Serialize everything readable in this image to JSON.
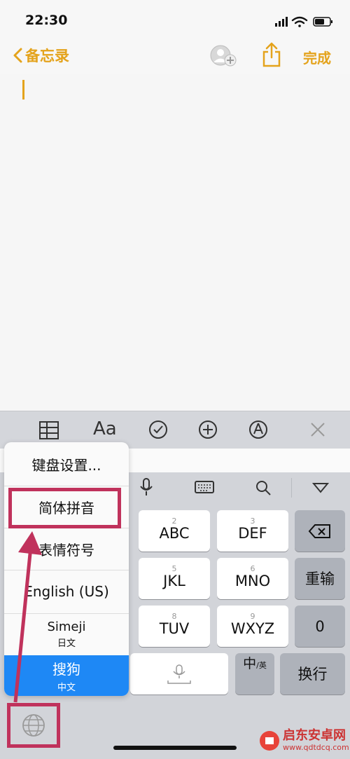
{
  "status": {
    "time": "22:30"
  },
  "nav": {
    "back_label": "备忘录",
    "done_label": "完成"
  },
  "keys": [
    {
      "num": "2",
      "label": "ABC"
    },
    {
      "num": "3",
      "label": "DEF"
    },
    {
      "num": "5",
      "label": "JKL"
    },
    {
      "num": "6",
      "label": "MNO"
    },
    {
      "num": "8",
      "label": "TUV"
    },
    {
      "num": "9",
      "label": "WXYZ"
    }
  ],
  "right_keys": {
    "chongshu": "重输",
    "zero": "0",
    "huanhang": "换行"
  },
  "lang_key": {
    "main": "中",
    "sub": "/英"
  },
  "menu": {
    "items": [
      {
        "label": "键盘设置..."
      },
      {
        "label": "简体拼音"
      },
      {
        "label": "表情符号"
      },
      {
        "label": "English (US)"
      },
      {
        "label": "Simeji",
        "sub": "日文"
      },
      {
        "label": "搜狗",
        "sub": "中文"
      }
    ]
  },
  "toolbar": {
    "format_label": "Aa"
  },
  "watermark": {
    "name": "启东安卓网",
    "url": "www.qdtdcq.com"
  },
  "colors": {
    "accent": "#e4a31c",
    "highlight": "#c0325c",
    "selected": "#1e88f5"
  }
}
